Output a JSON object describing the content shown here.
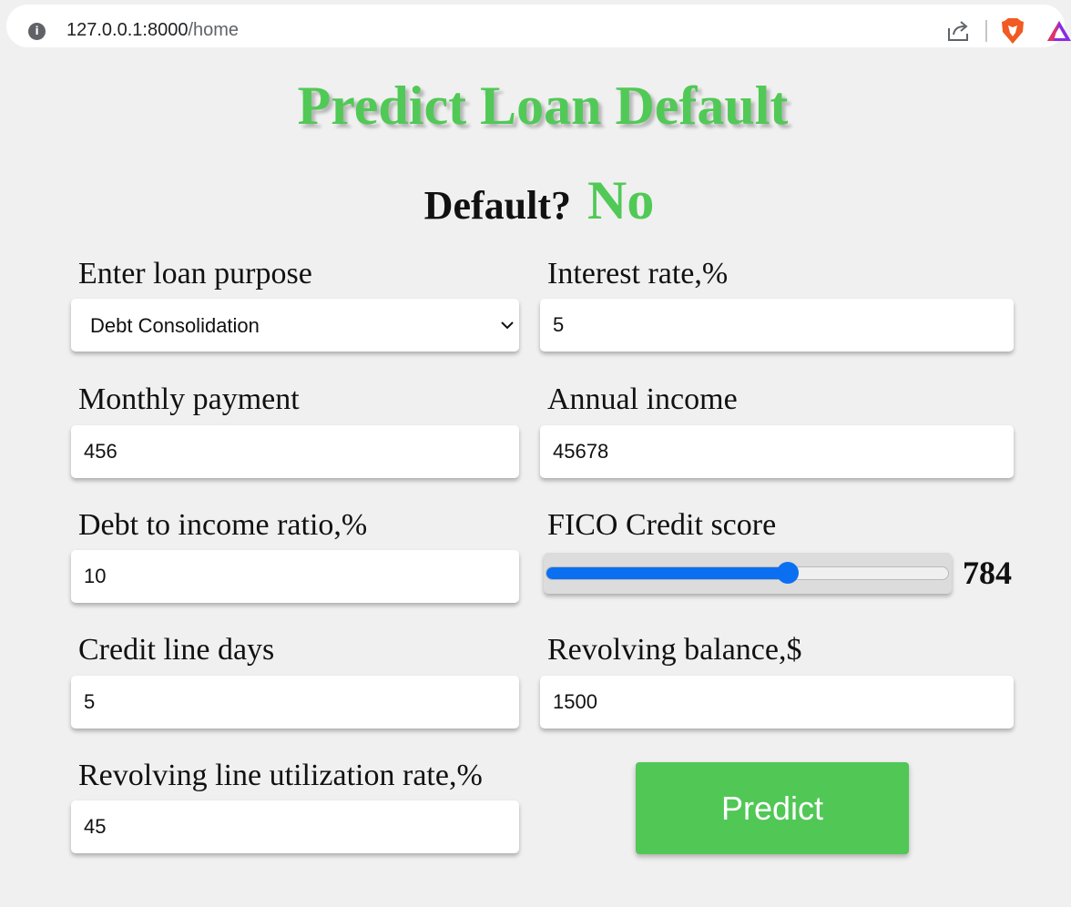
{
  "browser": {
    "url_host": "127.0.0.1:8000",
    "url_path": "/home",
    "info_icon": "i"
  },
  "page": {
    "title": "Predict Loan Default",
    "result_label": "Default?",
    "result_value": "No"
  },
  "fields": {
    "loan_purpose": {
      "label": "Enter loan purpose",
      "value": "Debt Consolidation"
    },
    "interest_rate": {
      "label": "Interest rate,%",
      "value": "5"
    },
    "monthly_payment": {
      "label": "Monthly payment",
      "value": "456"
    },
    "annual_income": {
      "label": "Annual income",
      "value": "45678"
    },
    "debt_to_income": {
      "label": "Debt to income ratio,%",
      "value": "10"
    },
    "fico": {
      "label": "FICO Credit score",
      "value": "784",
      "fill_fraction": 0.6
    },
    "credit_line_days": {
      "label": "Credit line days",
      "value": "5"
    },
    "revolving_balance": {
      "label": "Revolving balance,$",
      "value": "1500"
    },
    "revolving_util": {
      "label": "Revolving line utilization rate,%",
      "value": "45"
    }
  },
  "actions": {
    "predict_label": "Predict"
  },
  "colors": {
    "accent_green": "#51c956",
    "slider_blue": "#0b6ff2"
  },
  "icons": [
    "info-icon",
    "share-icon",
    "brave-icon",
    "rewards-icon",
    "chevron-down-icon"
  ]
}
